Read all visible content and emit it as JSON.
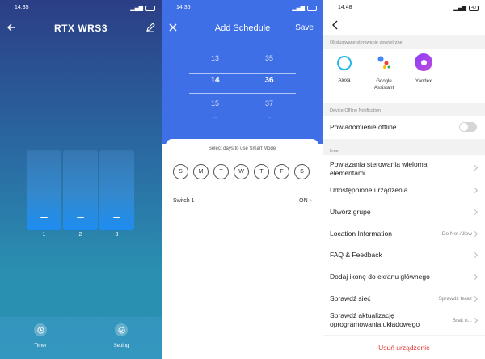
{
  "panel1": {
    "status_time": "14:35",
    "status_battery": "",
    "title": "RTX WRS3",
    "switches": [
      "1",
      "2",
      "3"
    ],
    "bottom": {
      "timer_label": "Timer",
      "setting_label": "Setting"
    }
  },
  "panel2": {
    "status_time": "14:36",
    "title": "Add Schedule",
    "save_label": "Save",
    "picker": {
      "hours": [
        "--",
        "13",
        "14",
        "15",
        "--"
      ],
      "minutes": [
        "--",
        "35",
        "36",
        "37",
        "--"
      ]
    },
    "days_title": "Select days to use Smart Mode",
    "days": [
      "S",
      "M",
      "T",
      "W",
      "T",
      "F",
      "S"
    ],
    "switch_label": "Switch 1",
    "switch_value": "ON"
  },
  "panel3": {
    "status_time": "14:48",
    "status_battery": "40",
    "section_external": "Obsługiwane sterowanie zewnętrzne",
    "assistants": [
      {
        "name": "Alexa",
        "icon": "alexa-icon"
      },
      {
        "name": "Google Assistant",
        "icon": "google-assistant-icon"
      },
      {
        "name": "Yandex",
        "icon": "yandex-icon"
      }
    ],
    "section_offline": "Device Offline Notification",
    "offline_label": "Powiadomienie offline",
    "section_other": "Inne",
    "rows": [
      {
        "label": "Powiązania sterowania wieloma elementami",
        "value": ""
      },
      {
        "label": "Udostępnione urządzenia",
        "value": ""
      },
      {
        "label": "Utwórz grupę",
        "value": ""
      },
      {
        "label": "Location Information",
        "value": "Do Not Allow"
      },
      {
        "label": "FAQ & Feedback",
        "value": ""
      },
      {
        "label": "Dodaj ikonę do ekranu głównego",
        "value": ""
      },
      {
        "label": "Sprawdź sieć",
        "value": "Sprawdź teraz"
      },
      {
        "label": "Sprawdź aktualizację oprogramowania układowego",
        "value": "Brak n..."
      }
    ],
    "remove_label": "Usuń urządzenie"
  },
  "colors": {
    "accent_blue": "#3e6fe6",
    "remove_red": "#e53935"
  }
}
